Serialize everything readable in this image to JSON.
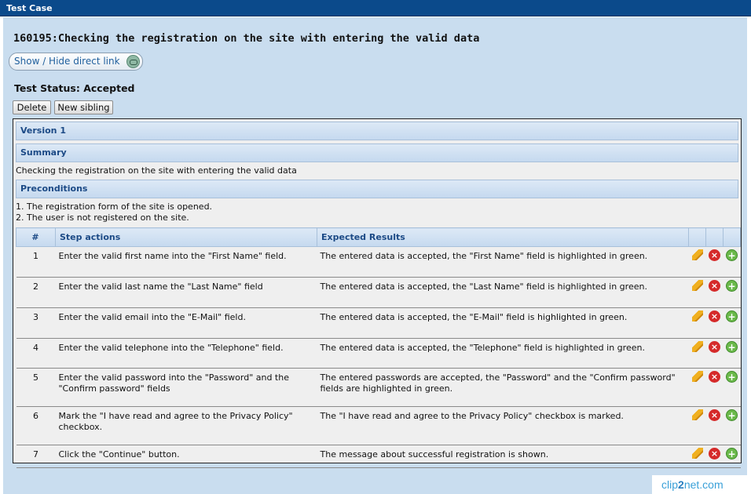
{
  "window": {
    "title": "Test Case"
  },
  "test_case": {
    "title": "160195:Checking the registration on the site with entering the valid data",
    "link_button": "Show / Hide direct link",
    "status": "Test Status: Accepted",
    "buttons": {
      "delete": "Delete",
      "new_sibling": "New sibling"
    }
  },
  "version": {
    "label": "Version 1",
    "summary_label": "Summary",
    "summary_text": "Checking the registration on the site with entering the valid data",
    "preconditions_label": "Preconditions",
    "preconditions": [
      "1. The registration form of the site is opened.",
      "2. The user is not registered on the site."
    ]
  },
  "steps_table": {
    "headers": {
      "num": "#",
      "actions": "Step actions",
      "results": "Expected Results"
    },
    "rows": [
      {
        "num": "1",
        "action": "Enter the valid first name into the \"First Name\" field.",
        "result": "The entered data is accepted, the \"First Name\" field is highlighted in green."
      },
      {
        "num": "2",
        "action": "Enter the valid last name the \"Last Name\" field",
        "result": "The entered data is accepted, the \"Last Name\" field is highlighted in green."
      },
      {
        "num": "3",
        "action": "Enter the valid email into the \"E-Mail\" field.",
        "result": "The entered data is accepted, the \"E-Mail\" field is highlighted in green."
      },
      {
        "num": "4",
        "action": "Enter the valid telephone into the \"Telephone\" field.",
        "result": "The entered data is accepted, the \"Telephone\" field is highlighted in green."
      },
      {
        "num": "5",
        "action": "Enter the valid password into the \"Password\" and the \"Confirm password\" fields",
        "result": "The entered passwords are accepted, the \"Password\" and the \"Confirm password\" fields are highlighted in green."
      },
      {
        "num": "6",
        "action": "Mark the \"I have read and agree to the Privacy Policy\" checkbox.",
        "result": "The \"I have read and agree to the Privacy Policy\" checkbox is marked."
      },
      {
        "num": "7",
        "action": "Click the \"Continue\" button.",
        "result": "The message about successful registration is shown."
      }
    ],
    "row_icons": [
      "pencil-icon",
      "delete-icon",
      "add-icon"
    ]
  },
  "watermark": {
    "part1": "clip",
    "part2": "2",
    "part3": "net",
    "part4": ".com"
  },
  "colors": {
    "titlebar": "#0b4a8b",
    "background": "#c9ddef",
    "header_text": "#1c4a86"
  }
}
